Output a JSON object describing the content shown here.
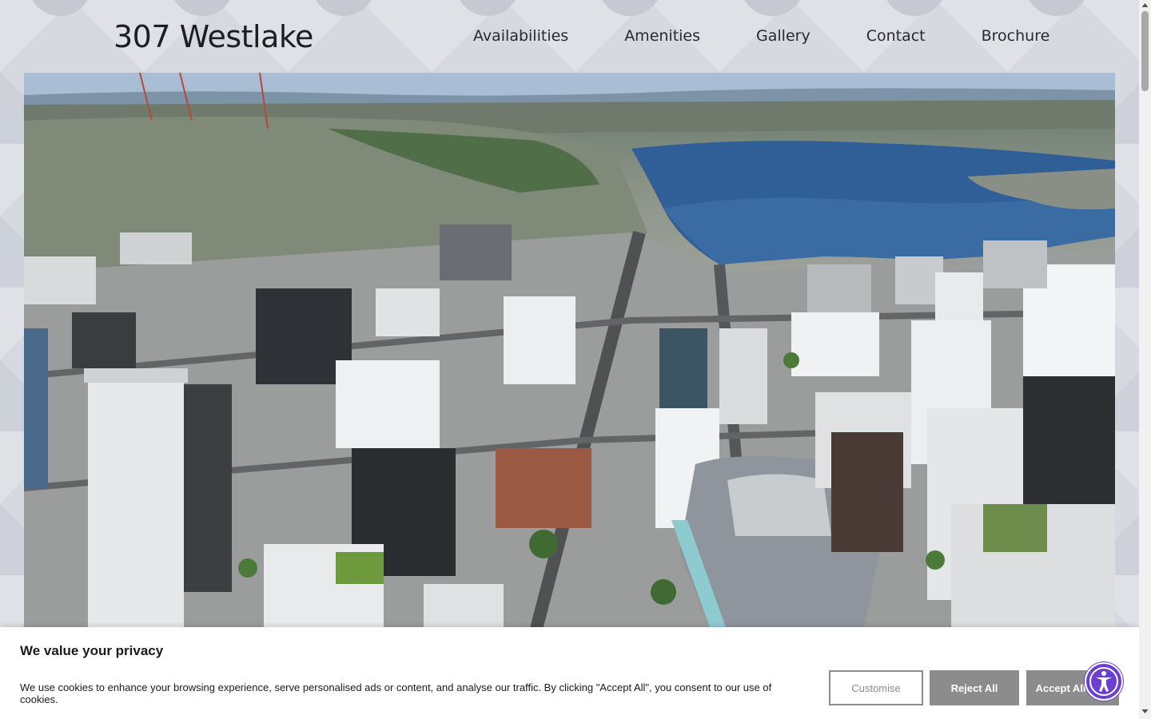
{
  "site": {
    "logo": "307 Westlake"
  },
  "nav": {
    "items": [
      "Availabilities",
      "Amenities",
      "Gallery",
      "Contact",
      "Brochure"
    ]
  },
  "hero": {
    "image_alt": "Aerial view of South Lake Union, Seattle"
  },
  "cookie_banner": {
    "title": "We value your privacy",
    "message": "We use cookies to enhance your browsing experience, serve personalised ads or content, and analyse our traffic. By clicking \"Accept All\", you consent to our use of cookies.",
    "customise_label": "Customise",
    "reject_label": "Reject All",
    "accept_label": "Accept All"
  },
  "colors": {
    "accent": "#6b3fd3",
    "button_gray": "#8c8c8c"
  },
  "icons": {
    "accessibility": "accessibility-icon"
  }
}
